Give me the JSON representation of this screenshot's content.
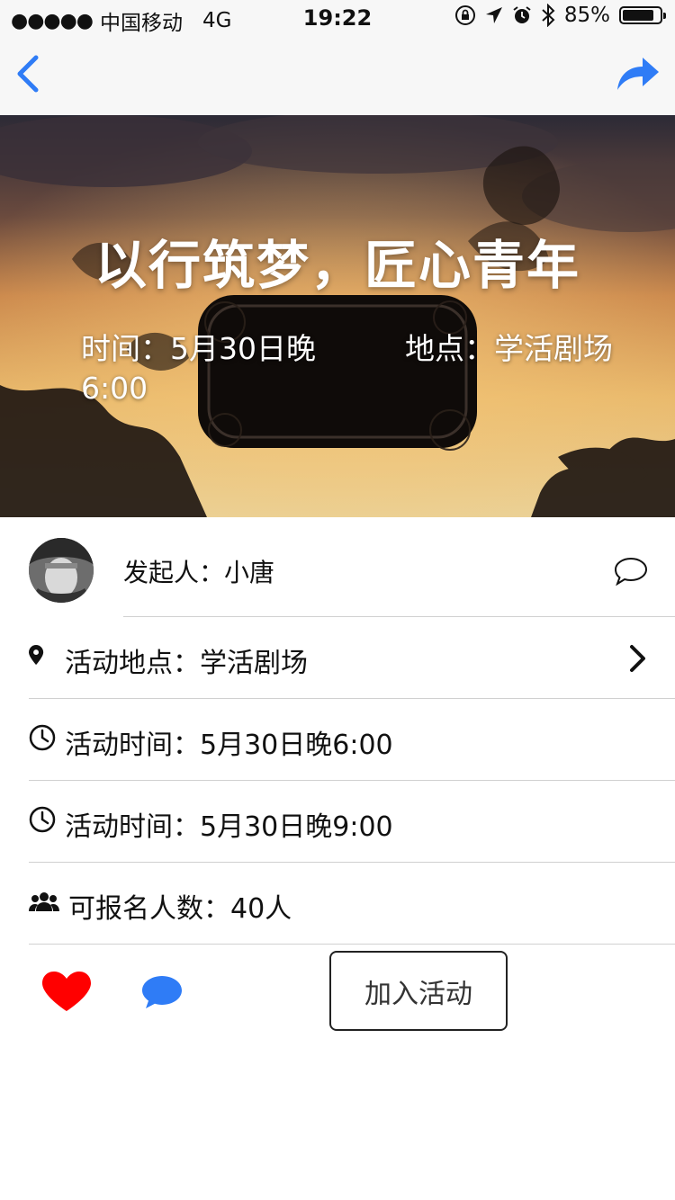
{
  "status_bar": {
    "signal": "●●●●●",
    "carrier": "中国移动",
    "network": "4G",
    "time": "19:22",
    "battery_percent": "85%",
    "battery_level": 0.85
  },
  "nav": {
    "back_icon": "chevron-left-icon",
    "share_icon": "share-arrow-icon",
    "accent_color": "#2f7cf6"
  },
  "hero": {
    "title": "以行筑梦，匠心青年",
    "time_label": "时间：",
    "time_value": "5月30日晚6:00",
    "place_label": "地点：",
    "place_value": "学活剧场"
  },
  "organizer": {
    "label": "发起人：",
    "name": "小唐"
  },
  "details": [
    {
      "icon": "location-pin-icon",
      "label": "活动地点：",
      "value": "学活剧场"
    },
    {
      "icon": "clock-icon",
      "label": "活动时间：",
      "value": "5月30日晚6:00"
    },
    {
      "icon": "clock-icon",
      "label": "活动时间：",
      "value": "5月30日晚9:00"
    },
    {
      "icon": "people-icon",
      "label": "可报名人数：",
      "value": "40人"
    }
  ],
  "actions": {
    "like_color": "#ff0000",
    "comment_color": "#2f7cf6",
    "join_label": "加入活动"
  }
}
